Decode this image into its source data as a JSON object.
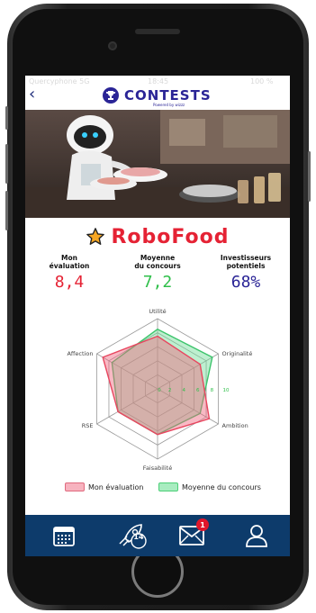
{
  "statusbar": {
    "carrier": "Quercyphone 5G",
    "time": "18:45",
    "battery": "100 %"
  },
  "navbar": {
    "back_label": "‹",
    "brand": "CONTESTS",
    "powered": "Powered by wizzz"
  },
  "project": {
    "name": "RoboFood"
  },
  "stats": [
    {
      "label_line1": "Mon",
      "label_line2": "évaluation",
      "value": "8,4",
      "color": "#e52234"
    },
    {
      "label_line1": "Moyenne",
      "label_line2": "du concours",
      "value": "7,2",
      "color": "#2fbf4a"
    },
    {
      "label_line1": "Investisseurs",
      "label_line2": "potentiels",
      "value": "68%",
      "color": "#2a2496"
    }
  ],
  "chart_data": {
    "type": "radar",
    "axes": [
      "Utilité",
      "Originalité",
      "Ambition",
      "Faisabilité",
      "RSE",
      "Affection"
    ],
    "scale": {
      "min": 0,
      "max": 10,
      "ticks": [
        "0",
        "2",
        "4",
        "6",
        "8",
        "10"
      ]
    },
    "series": [
      {
        "name": "Mon évaluation",
        "values": [
          7.5,
          7.0,
          8.5,
          6.5,
          6.5,
          9.0
        ],
        "color": "#f08a9a"
      },
      {
        "name": "Moyenne du concours",
        "values": [
          8.5,
          9.0,
          7.0,
          6.5,
          6.5,
          7.5
        ],
        "color": "#7fe0a0"
      }
    ]
  },
  "tabbar": {
    "items": [
      "calendar",
      "rocket",
      "mail",
      "profile"
    ],
    "rocket_count": "14",
    "mail_badge": "1"
  }
}
